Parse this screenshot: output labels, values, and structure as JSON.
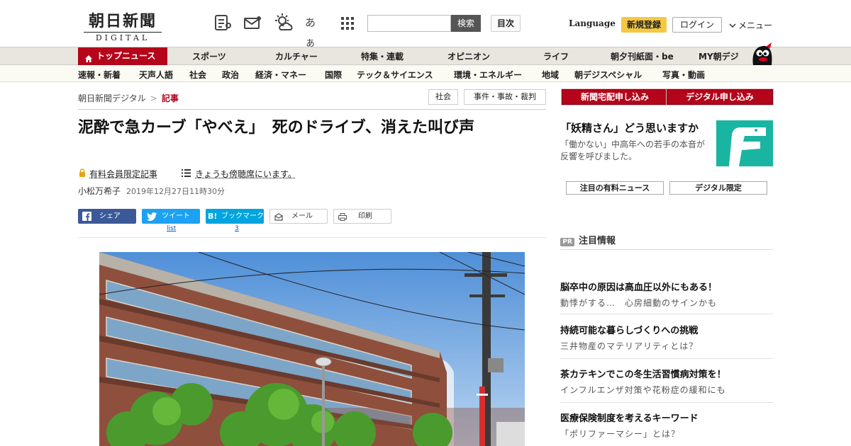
{
  "header": {
    "logo_jp": "朝日新聞",
    "logo_en": "DIGITAL",
    "icons": [
      "news-icon",
      "mail-icon",
      "weather-icon",
      "font-size-icon",
      "apps-grid-icon"
    ],
    "font_size_label": "あぁ",
    "search_placeholder": "",
    "search_button": "検索",
    "toc_button": "目次",
    "language": "Language",
    "register": "新規登録",
    "login": "ログイン",
    "menu": "メニュー"
  },
  "nav_main": [
    {
      "label": "トップニュース",
      "active": true
    },
    {
      "label": "スポーツ"
    },
    {
      "label": "カルチャー"
    },
    {
      "label": "特集・連載"
    },
    {
      "label": "オピニオン"
    },
    {
      "label": "ライフ"
    },
    {
      "label": "朝夕刊紙面・be"
    },
    {
      "label": "MY朝デジ"
    }
  ],
  "nav_sub": [
    "速報・新着",
    "天声人語",
    "社会",
    "政治",
    "経済・マネー",
    "国際",
    "テック＆サイエンス",
    "環境・エネルギー",
    "地域",
    "朝デジスペシャル",
    "写真・動画"
  ],
  "breadcrumb": {
    "home": "朝日新聞デジタル",
    "sep": ">",
    "current": "記事"
  },
  "tags": [
    "社会",
    "事件・事故・裁判"
  ],
  "article": {
    "title": "泥酔で急カーブ「やべえ」　死のドライブ、消えた叫び声",
    "paid_label": "有料会員限定記事",
    "series_label": "きょうも傍聴席にいます。",
    "author": "小松万希子",
    "date": "2019年12月27日11時30分"
  },
  "share": {
    "facebook": "シェア",
    "twitter": "ツイート",
    "hatena_icon": "B!",
    "hatena": "ブックマーク",
    "mail": "メール",
    "print": "印刷",
    "twitter_count": "list",
    "hatena_count": "3"
  },
  "sidebar": {
    "subscribe_paper": "新聞宅配申し込み",
    "subscribe_digital": "デジタル申し込み",
    "feature_title": "「妖精さん」どう思いますか",
    "feature_desc": "「働かない」中高年への若手の本音が反響を呼びました。",
    "btn_paid_news": "注目の有料ニュース",
    "btn_digital_only": "デジタル限定",
    "pr_badge": "PR",
    "pr_heading": "注目情報",
    "pr_items": [
      {
        "title": "脳卒中の原因は高血圧以外にもある！",
        "sub": "動悸がする…　心房細動のサインかも"
      },
      {
        "title": "持続可能な暮らしづくりへの挑戦",
        "sub": "三井物産のマテリアリティとは？"
      },
      {
        "title": "茶カテキンでこの冬生活習慣病対策を！",
        "sub": "インフルエンザ対策や花粉症の緩和にも"
      },
      {
        "title": "医療保険制度を考えるキーワード",
        "sub": "「ポリファーマシー」とは？"
      }
    ]
  },
  "colors": {
    "brand_red": "#b4051b",
    "facebook": "#3b5998",
    "twitter": "#1da1f2",
    "hatena": "#00a4de",
    "register_yellow": "#f5c842",
    "teal": "#1ab5a2"
  }
}
